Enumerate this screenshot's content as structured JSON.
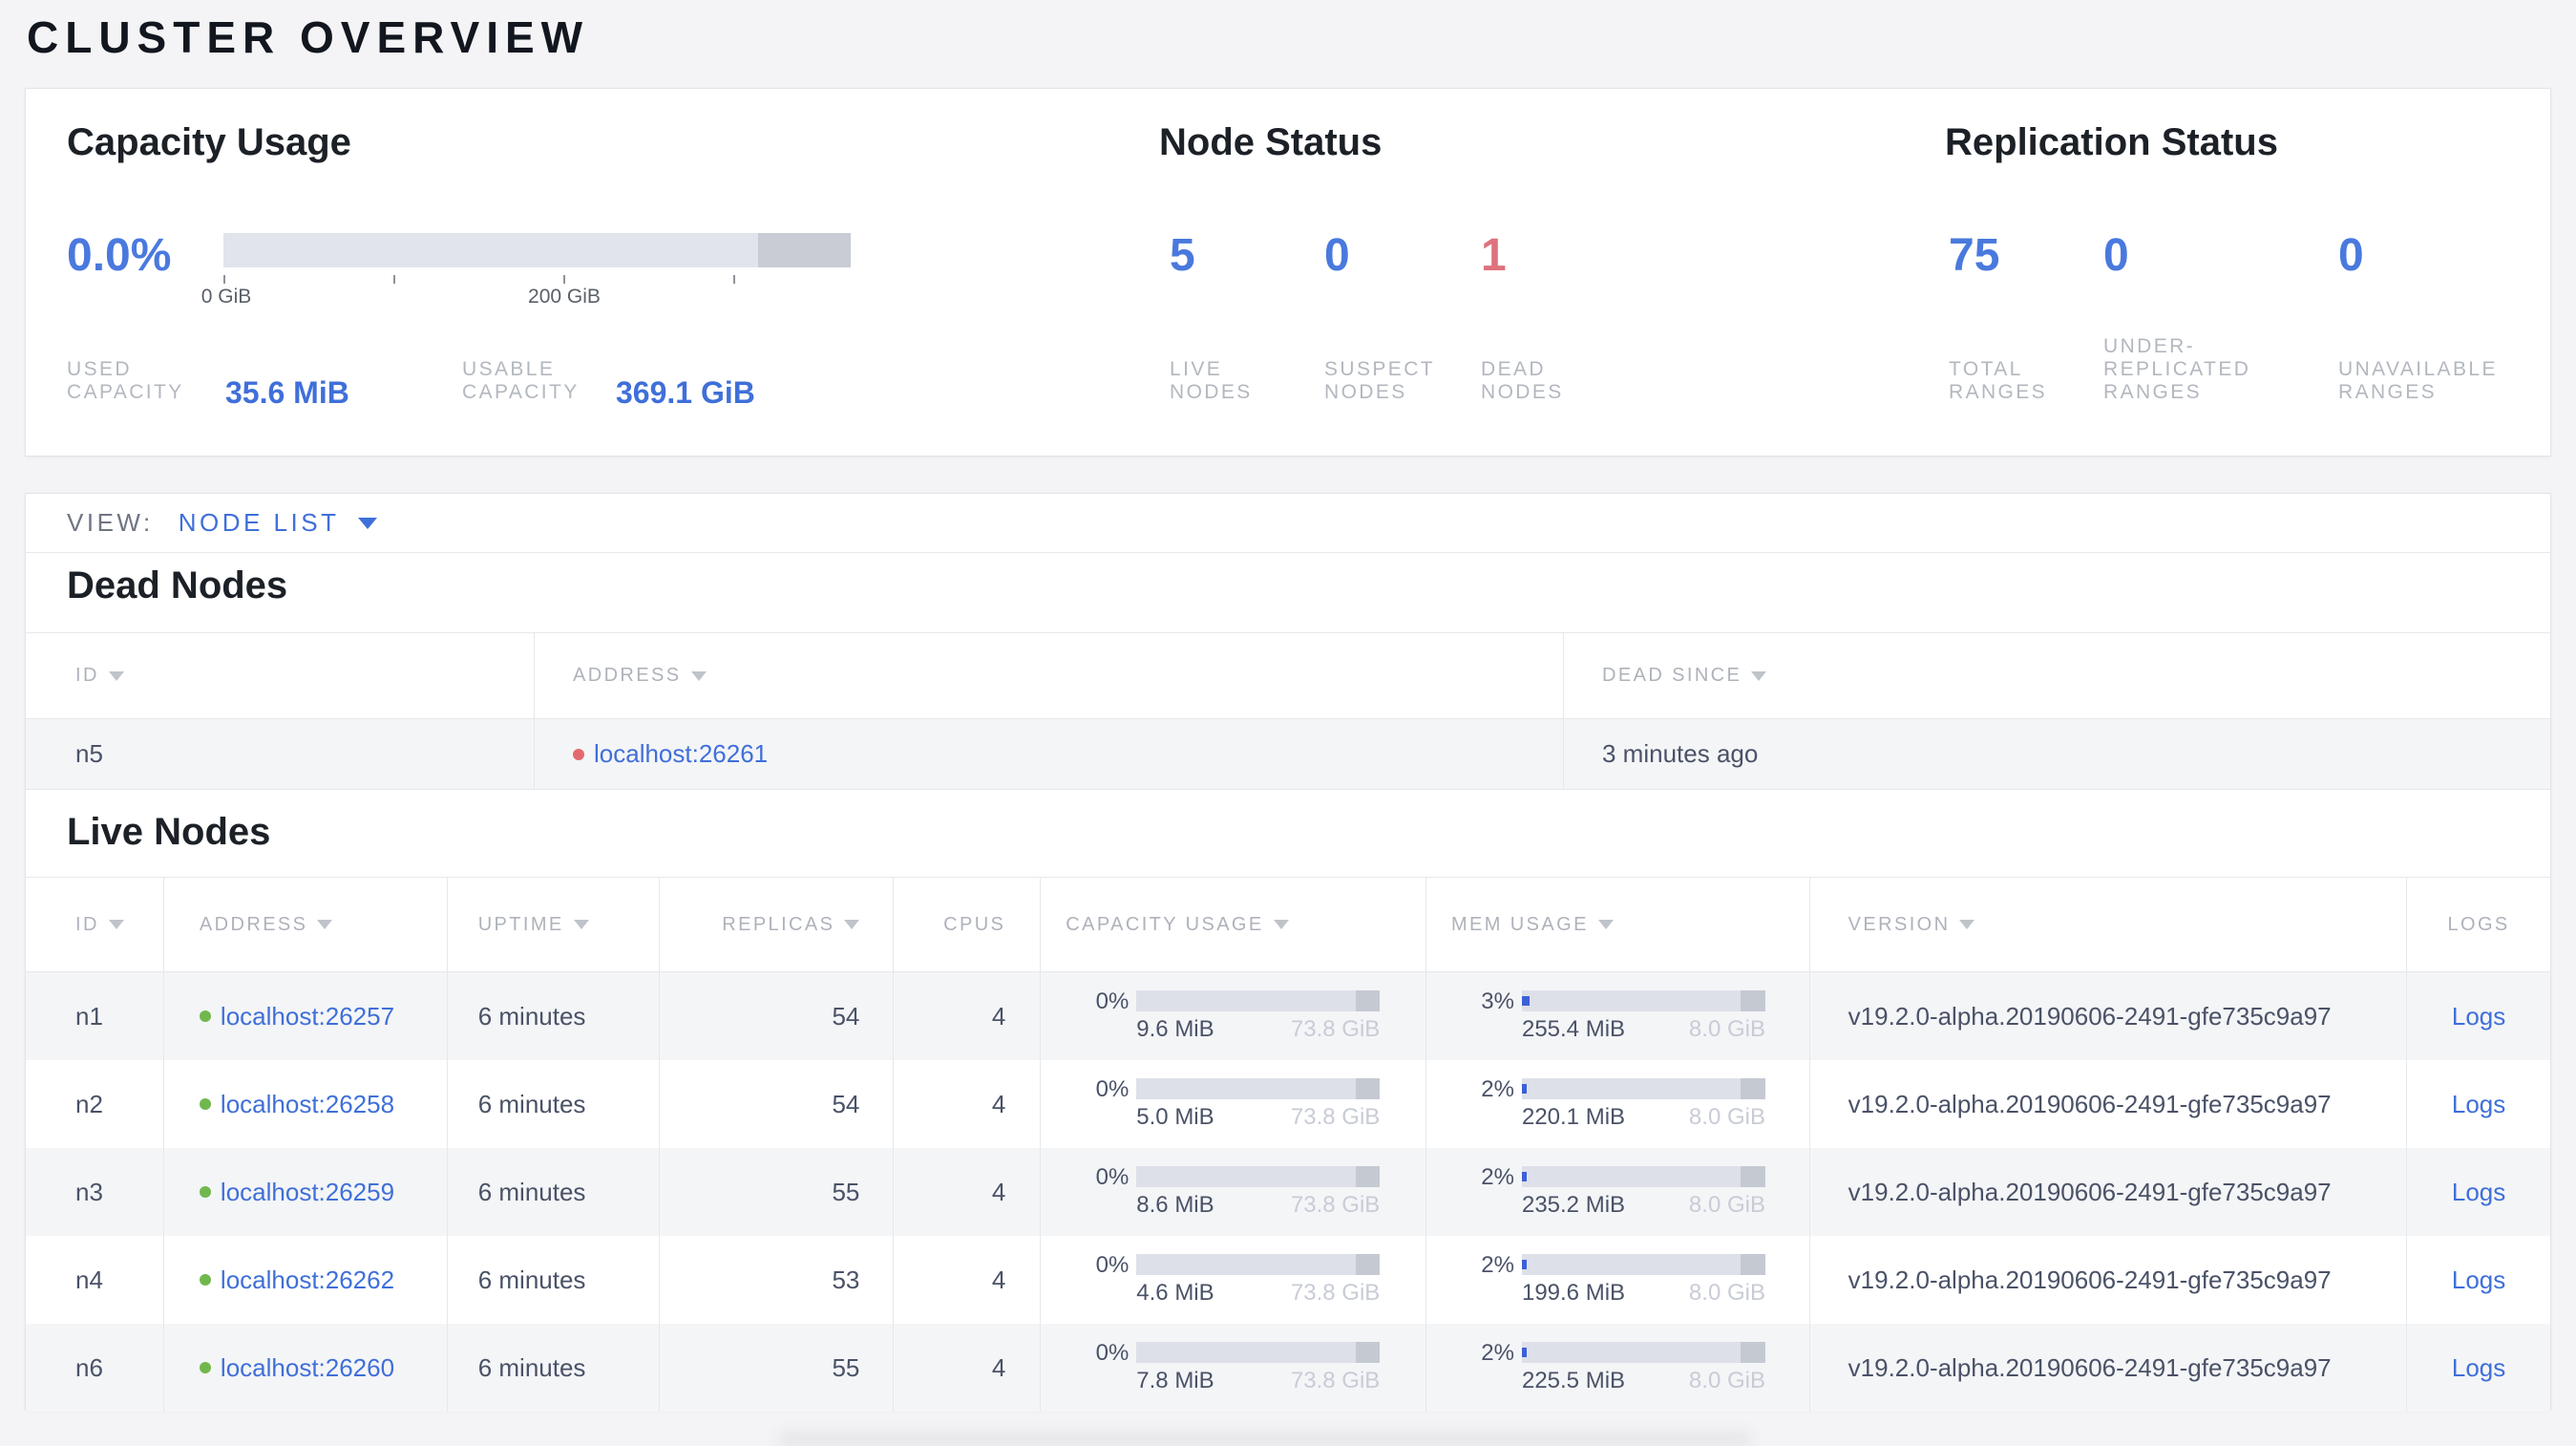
{
  "page_title": "CLUSTER OVERVIEW",
  "colors": {
    "accent_blue": "#3f6fd9",
    "big_number_blue": "#4a79de",
    "dead_red": "#df717d",
    "live_dot_green": "#70b84d",
    "dead_dot_red": "#e2696d",
    "bar_fill_blue": "#3b60d8"
  },
  "summary": {
    "capacity": {
      "title": "Capacity Usage",
      "percent": "0.0%",
      "axis_tick_labels": [
        "0 GiB",
        "200 GiB"
      ],
      "used": {
        "label_lines": [
          "USED",
          "CAPACITY"
        ],
        "value": "35.6 MiB"
      },
      "usable": {
        "label_lines": [
          "USABLE",
          "CAPACITY"
        ],
        "value": "369.1 GiB"
      }
    },
    "node_status": {
      "title": "Node Status",
      "stats": [
        {
          "value": "5",
          "lines": [
            "LIVE",
            "NODES"
          ]
        },
        {
          "value": "0",
          "lines": [
            "SUSPECT",
            "NODES"
          ]
        },
        {
          "value": "1",
          "lines": [
            "DEAD",
            "NODES"
          ]
        }
      ]
    },
    "replication": {
      "title": "Replication Status",
      "stats": [
        {
          "value": "75",
          "lines": [
            "TOTAL",
            "RANGES"
          ]
        },
        {
          "value": "0",
          "lines": [
            "UNDER-",
            "REPLICATED",
            "RANGES"
          ]
        },
        {
          "value": "0",
          "lines": [
            "UNAVAILABLE",
            "RANGES"
          ]
        }
      ]
    }
  },
  "view_bar": {
    "label": "VIEW:",
    "selected": "NODE LIST"
  },
  "dead_nodes": {
    "heading": "Dead Nodes",
    "columns": [
      {
        "label": "ID"
      },
      {
        "label": "ADDRESS"
      },
      {
        "label": "DEAD SINCE"
      }
    ],
    "rows": [
      {
        "id": "n5",
        "address": "localhost:26261",
        "dead_since": "3 minutes ago"
      }
    ]
  },
  "live_nodes": {
    "heading": "Live Nodes",
    "columns": [
      {
        "label": "ID"
      },
      {
        "label": "ADDRESS"
      },
      {
        "label": "UPTIME"
      },
      {
        "label": "REPLICAS"
      },
      {
        "label": "CPUS"
      },
      {
        "label": "CAPACITY USAGE"
      },
      {
        "label": "MEM USAGE"
      },
      {
        "label": "VERSION"
      },
      {
        "label": "LOGS"
      }
    ],
    "rows": [
      {
        "id": "n1",
        "address": "localhost:26257",
        "uptime": "6 minutes",
        "replicas": "54",
        "cpus": "4",
        "capacity": {
          "percent": "0%",
          "used": "9.6 MiB",
          "total": "73.8 GiB",
          "fill_pct": 0
        },
        "mem": {
          "percent": "3%",
          "used": "255.4 MiB",
          "total": "8.0 GiB",
          "fill_pct": 3
        },
        "version": "v19.2.0-alpha.20190606-2491-gfe735c9a97",
        "logs": "Logs"
      },
      {
        "id": "n2",
        "address": "localhost:26258",
        "uptime": "6 minutes",
        "replicas": "54",
        "cpus": "4",
        "capacity": {
          "percent": "0%",
          "used": "5.0 MiB",
          "total": "73.8 GiB",
          "fill_pct": 0
        },
        "mem": {
          "percent": "2%",
          "used": "220.1 MiB",
          "total": "8.0 GiB",
          "fill_pct": 2
        },
        "version": "v19.2.0-alpha.20190606-2491-gfe735c9a97",
        "logs": "Logs"
      },
      {
        "id": "n3",
        "address": "localhost:26259",
        "uptime": "6 minutes",
        "replicas": "55",
        "cpus": "4",
        "capacity": {
          "percent": "0%",
          "used": "8.6 MiB",
          "total": "73.8 GiB",
          "fill_pct": 0
        },
        "mem": {
          "percent": "2%",
          "used": "235.2 MiB",
          "total": "8.0 GiB",
          "fill_pct": 2
        },
        "version": "v19.2.0-alpha.20190606-2491-gfe735c9a97",
        "logs": "Logs"
      },
      {
        "id": "n4",
        "address": "localhost:26262",
        "uptime": "6 minutes",
        "replicas": "53",
        "cpus": "4",
        "capacity": {
          "percent": "0%",
          "used": "4.6 MiB",
          "total": "73.8 GiB",
          "fill_pct": 0
        },
        "mem": {
          "percent": "2%",
          "used": "199.6 MiB",
          "total": "8.0 GiB",
          "fill_pct": 2
        },
        "version": "v19.2.0-alpha.20190606-2491-gfe735c9a97",
        "logs": "Logs"
      },
      {
        "id": "n6",
        "address": "localhost:26260",
        "uptime": "6 minutes",
        "replicas": "55",
        "cpus": "4",
        "capacity": {
          "percent": "0%",
          "used": "7.8 MiB",
          "total": "73.8 GiB",
          "fill_pct": 0
        },
        "mem": {
          "percent": "2%",
          "used": "225.5 MiB",
          "total": "8.0 GiB",
          "fill_pct": 2
        },
        "version": "v19.2.0-alpha.20190606-2491-gfe735c9a97",
        "logs": "Logs"
      }
    ]
  }
}
